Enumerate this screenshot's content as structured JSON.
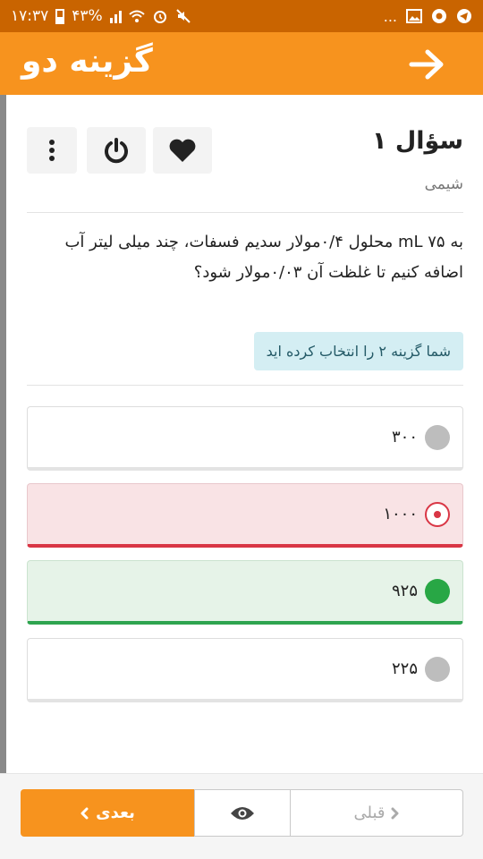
{
  "status_bar": {
    "time": "۱۷:۳۷",
    "battery": "۴۳%",
    "more": "..."
  },
  "app_bar": {
    "logo": "گزینه دو"
  },
  "question": {
    "title": "سؤال ۱",
    "subject": "شیمی",
    "text": "به ۷۵ mL محلول ۰/۴مولار سدیم فسفات، چند میلی لیتر آب اضافه کنیم تا غلظت آن ۰/۰۳مولار شود؟",
    "notice": "شما گزینه ۲ را انتخاب کرده اید"
  },
  "options": [
    {
      "label": "۳۰۰",
      "state": "neutral"
    },
    {
      "label": "۱۰۰۰",
      "state": "selected-wrong"
    },
    {
      "label": "۹۲۵",
      "state": "correct"
    },
    {
      "label": "۲۲۵",
      "state": "neutral"
    }
  ],
  "nav": {
    "next_label": "بعدی",
    "prev_label": "قبلی"
  },
  "colors": {
    "brand": "#f7931e",
    "wrong": "#d93645",
    "correct": "#28a745"
  }
}
